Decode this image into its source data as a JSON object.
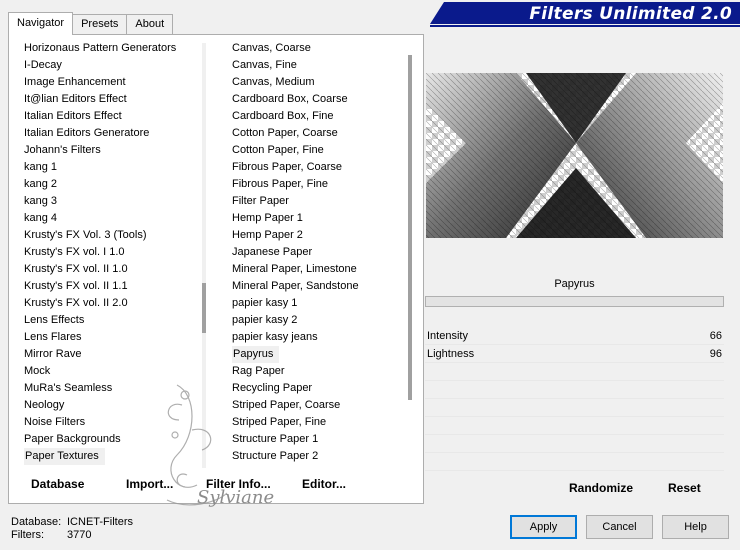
{
  "tabs": [
    "Navigator",
    "Presets",
    "About"
  ],
  "title": "Filters Unlimited 2.0",
  "categories": [
    "Horizonaus Pattern Generators",
    "I-Decay",
    "Image Enhancement",
    "It@lian Editors Effect",
    "Italian Editors Effect",
    "Italian Editors Generatore",
    "Johann's Filters",
    "kang 1",
    "kang 2",
    "kang 3",
    "kang 4",
    "Krusty's FX Vol. 3 (Tools)",
    "Krusty's FX vol. I 1.0",
    "Krusty's FX vol. II 1.0",
    "Krusty's FX vol. II 1.1",
    "Krusty's FX vol. II 2.0",
    "Lens Effects",
    "Lens Flares",
    "Mirror Rave",
    "Mock",
    "MuRa's Seamless",
    "Neology",
    "Noise Filters",
    "Paper Backgrounds",
    "Paper Textures"
  ],
  "selected_category": "Paper Textures",
  "filters": [
    "Canvas, Coarse",
    "Canvas, Fine",
    "Canvas, Medium",
    "Cardboard Box, Coarse",
    "Cardboard Box, Fine",
    "Cotton Paper, Coarse",
    "Cotton Paper, Fine",
    "Fibrous Paper, Coarse",
    "Fibrous Paper, Fine",
    "Filter Paper",
    "Hemp Paper 1",
    "Hemp Paper 2",
    "Japanese Paper",
    "Mineral Paper, Limestone",
    "Mineral Paper, Sandstone",
    "papier kasy 1",
    "papier kasy 2",
    "papier kasy jeans",
    "Papyrus",
    "Rag Paper",
    "Recycling Paper",
    "Striped Paper, Coarse",
    "Striped Paper, Fine",
    "Structure Paper 1",
    "Structure Paper 2"
  ],
  "selected_filter": "Papyrus",
  "left_buttons": {
    "database": "Database",
    "import": "Import...",
    "filter_info": "Filter Info...",
    "editor": "Editor..."
  },
  "preview": {
    "filter_name": "Papyrus"
  },
  "params": [
    {
      "label": "Intensity",
      "value": "66"
    },
    {
      "label": "Lightness",
      "value": "96"
    }
  ],
  "right_buttons": {
    "randomize": "Randomize",
    "reset": "Reset"
  },
  "status": {
    "database_label": "Database:",
    "database_value": "ICNET-Filters",
    "filters_label": "Filters:",
    "filters_value": "3770"
  },
  "dialog_buttons": {
    "apply": "Apply",
    "cancel": "Cancel",
    "help": "Help"
  },
  "watermark_text": "Sylviane",
  "colors": {
    "banner": "#0a1a8c",
    "accent": "#0078d7"
  }
}
